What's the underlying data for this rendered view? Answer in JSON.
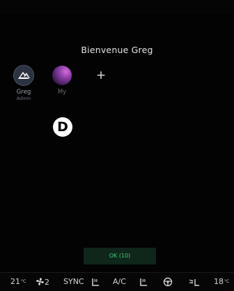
{
  "welcome": "Bienvenue Greg",
  "profiles": [
    {
      "name": "Greg",
      "role": "Admin",
      "avatar_icon": "alpine-logo-icon"
    },
    {
      "name": "My",
      "avatar_icon": "gradient-avatar"
    }
  ],
  "add_profile": "+",
  "callout_badge": "D",
  "ok_button": "OK (10)",
  "hvac": {
    "left_temp": "21",
    "left_unit": "°C",
    "fan_speed": "2",
    "sync": "SYNC",
    "ac": "A/C",
    "right_temp": "18",
    "right_unit": "°C"
  },
  "colors": {
    "background": "#030303",
    "ok_text": "#3fd07a",
    "ok_bg": "#0f261a"
  }
}
